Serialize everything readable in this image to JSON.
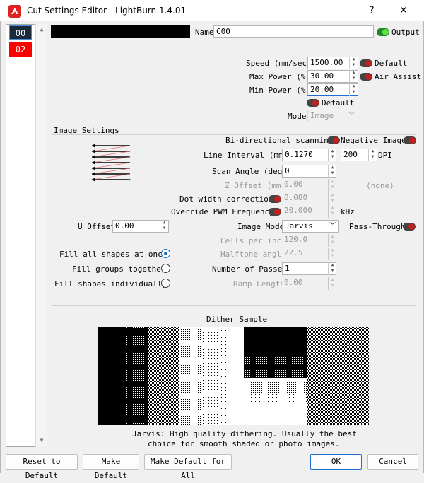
{
  "window": {
    "title": "Cut Settings Editor - LightBurn 1.4.01",
    "help_label": "?",
    "close_label": "✕"
  },
  "layers": [
    {
      "label": "00",
      "color": "#1a2a3a"
    },
    {
      "label": "02",
      "color": "#ff0000"
    }
  ],
  "header": {
    "name_label": "Name",
    "name_value": "C00",
    "output_label": "Output",
    "output_on": true
  },
  "speed": {
    "label": "Speed (mm/sec)",
    "value": "1500.00",
    "default_label": "Default"
  },
  "max_power": {
    "label": "Max Power (%)",
    "value": "30.00",
    "air_assist_label": "Air Assist"
  },
  "min_power": {
    "label": "Min Power (%)",
    "value": "20.00"
  },
  "default_toggle_label": "Default",
  "mode": {
    "label": "Mode",
    "value": "Image"
  },
  "image_settings": {
    "title": "Image Settings",
    "bidirectional_label": "Bi-directional scanning",
    "negative_image_label": "Negative Image",
    "line_interval_label": "Line Interval (mm)",
    "line_interval_value": "0.1270",
    "dpi_value": "200",
    "dpi_label": "DPI",
    "scan_angle_label": "Scan Angle (deg)",
    "scan_angle_value": "0",
    "z_offset_label": "Z Offset (mm)",
    "z_offset_value": "0.00",
    "z_offset_none": "(none)",
    "dot_width_label": "Dot width correction",
    "dot_width_value": "0.080",
    "pwm_label": "Override PWM Frequency",
    "pwm_value": "20.000",
    "pwm_unit": "kHz",
    "u_offset_label": "U Offset",
    "u_offset_value": "0.00",
    "image_mode_label": "Image Mode",
    "image_mode_value": "Jarvis",
    "pass_through_label": "Pass-Through",
    "cells_label": "Cells per inch",
    "cells_value": "120.0",
    "halftone_label": "Halftone angle",
    "halftone_value": "22.5",
    "passes_label": "Number of Passes",
    "passes_value": "1",
    "ramp_label": "Ramp Length",
    "ramp_value": "0.00",
    "fill_all_label": "Fill all shapes at once",
    "fill_groups_label": "Fill groups together",
    "fill_individual_label": "Fill shapes individually"
  },
  "dither": {
    "title": "Dither Sample",
    "description_line1": "Jarvis: High quality dithering. Usually the best",
    "description_line2": "choice for smooth shaded or photo images."
  },
  "footer": {
    "reset_label": "Reset to Default",
    "make_default_label": "Make Default",
    "make_default_all_label": "Make Default for All",
    "ok_label": "OK",
    "cancel_label": "Cancel"
  }
}
